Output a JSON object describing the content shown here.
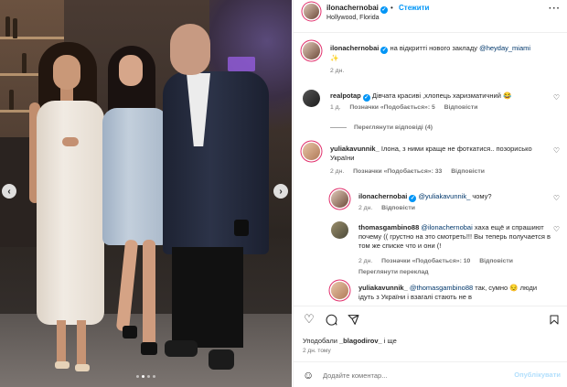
{
  "post": {
    "author": "ilonachernobai",
    "follow_label": "Стежити",
    "separator": "•",
    "location": "Hollywood, Florida",
    "more": "···"
  },
  "caption": {
    "user": "ilonachernobai",
    "text_before": "на відкритті нового закладу ",
    "mention": "@heyday_miami",
    "emoji": "✨",
    "time": "2 дн."
  },
  "comments": [
    {
      "user": "realpotap",
      "text": "Дівчата красиві ,хлопець харизматичний 😂",
      "time": "1 д.",
      "likes": "Позначки «Подобається»: 5",
      "reply": "Відповісти",
      "view_replies": "Переглянути відповіді (4)"
    },
    {
      "user": "yuliakavunnik_",
      "text": "Ілона, з ними краще не фоткатися.. позорисько України",
      "time": "2 дн.",
      "likes": "Позначки «Подобається»: 33",
      "reply": "Відповісти"
    },
    {
      "user": "ilonachernobai",
      "mention": "@yuliakavunnik_",
      "text": " чому?",
      "time": "2 дн.",
      "reply": "Відповісти"
    },
    {
      "user": "thomasgambino88",
      "mention": "@ilonachernobai",
      "text": " хаха ещё и спрашиют почему (( грустно на это смотреть!!! Вы теперь получается в том же списке что и они (!",
      "time": "2 дн.",
      "likes": "Позначки «Подобається»: 10",
      "reply": "Відповісти",
      "translate": "Переглянути переклад"
    },
    {
      "user": "yuliakavunnik_",
      "mention": "@thomasgambino88",
      "text": " так, сумно 😔 люди ідуть з України і взагалі стають не в"
    }
  ],
  "actions": {
    "like_icon": "heart-icon",
    "comment_icon": "comment-icon",
    "share_icon": "share-icon",
    "save_icon": "bookmark-icon"
  },
  "likes": {
    "prefix": "Уподобали ",
    "user": "_blagodirov_",
    "suffix": " і ще"
  },
  "post_time": "2 дн. тому",
  "add_comment": {
    "placeholder": "Додайте коментар...",
    "publish_label": "Опублікувати"
  },
  "carousel": {
    "prev": "‹",
    "next": "›",
    "total": 4,
    "active": 1
  }
}
